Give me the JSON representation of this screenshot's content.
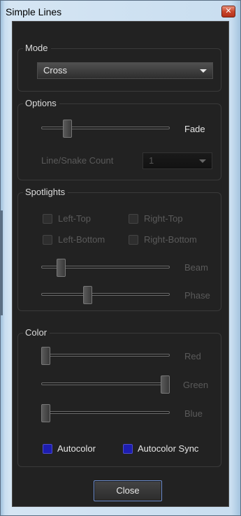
{
  "window": {
    "title": "Simple Lines"
  },
  "mode": {
    "label": "Mode",
    "selected": "Cross"
  },
  "options": {
    "label": "Options",
    "fade_label": "Fade",
    "fade_value": 0.18,
    "count_label": "Line/Snake Count",
    "count_selected": "1"
  },
  "spotlights": {
    "label": "Spotlights",
    "left_top": "Left-Top",
    "right_top": "Right-Top",
    "left_bottom": "Left-Bottom",
    "right_bottom": "Right-Bottom",
    "beam_label": "Beam",
    "beam_value": 0.13,
    "phase_label": "Phase",
    "phase_value": 0.35
  },
  "color": {
    "label": "Color",
    "red_label": "Red",
    "red_value": 0.0,
    "green_label": "Green",
    "green_value": 1.0,
    "blue_label": "Blue",
    "blue_value": 0.0,
    "autocolor": "Autocolor",
    "autocolor_sync": "Autocolor Sync",
    "checkbox_color": "#1d1db0"
  },
  "buttons": {
    "close": "Close"
  }
}
